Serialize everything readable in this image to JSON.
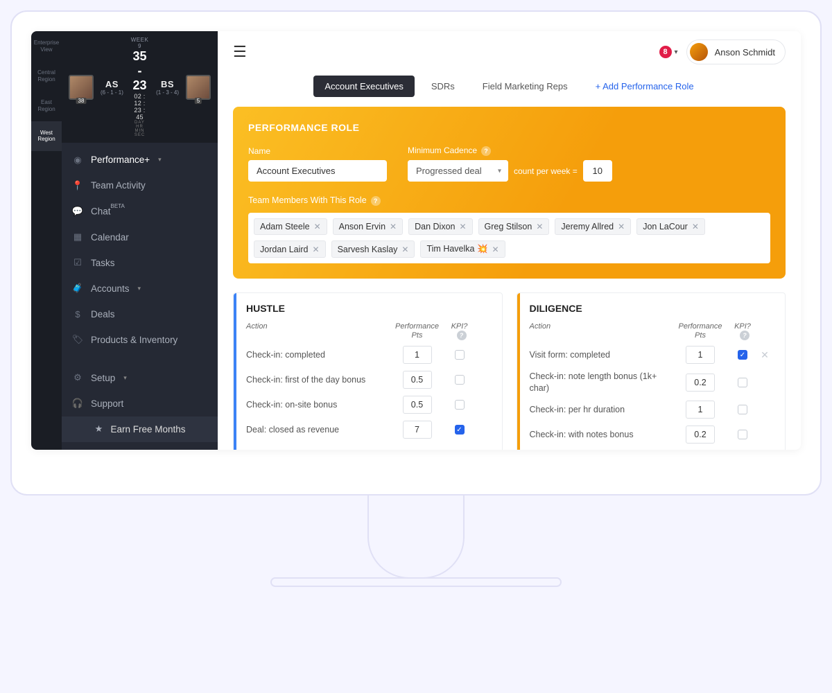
{
  "scoreboard": {
    "week": "WEEK 9",
    "leftTeam": "AS",
    "leftRecord": "(6 - 1 - 1)",
    "leftBadge": "38",
    "rightTeam": "BS",
    "rightRecord": "(1 - 3 - 4)",
    "rightBadge": "5",
    "score": "35 - 23",
    "countdown": "02 : 12 : 23 : 45",
    "countdownLabels": "DAY   HR   MIN   SEC"
  },
  "rail": [
    "Enterprise View",
    "Central Region",
    "East Region",
    "West Region"
  ],
  "nav": {
    "performance": "Performance+",
    "teamActivity": "Team Activity",
    "chat": "Chat",
    "chatBadge": "BETA",
    "calendar": "Calendar",
    "tasks": "Tasks",
    "accounts": "Accounts",
    "deals": "Deals",
    "products": "Products & Inventory",
    "setup": "Setup",
    "support": "Support",
    "earn": "Earn Free Months"
  },
  "topbar": {
    "notifCount": "8",
    "userName": "Anson Schmidt"
  },
  "tabs": {
    "ae": "Account Executives",
    "sdr": "SDRs",
    "fmr": "Field Marketing Reps",
    "add": "+ Add Performance Role"
  },
  "role": {
    "cardTitle": "PERFORMANCE ROLE",
    "nameLabel": "Name",
    "nameValue": "Account Executives",
    "cadenceLabel": "Minimum Cadence",
    "cadenceSelect": "Progressed deal",
    "cadenceText": "count per week =",
    "cadenceCount": "10",
    "membersLabel": "Team Members With This Role",
    "members": [
      "Adam Steele",
      "Anson Ervin",
      "Dan Dixon",
      "Greg Stilson",
      "Jeremy Allred",
      "Jon LaCour",
      "Jordan Laird",
      "Sarvesh Kaslay",
      "Tim Havelka 💥"
    ]
  },
  "panels": {
    "hustle": {
      "title": "HUSTLE",
      "headAction": "Action",
      "headPts": "Performance Pts",
      "headKpi": "KPI?",
      "rows": [
        {
          "action": "Check-in: completed",
          "pts": "1",
          "kpi": false
        },
        {
          "action": "Check-in: first of the day bonus",
          "pts": "0.5",
          "kpi": false
        },
        {
          "action": "Check-in: on-site bonus",
          "pts": "0.5",
          "kpi": false
        },
        {
          "action": "Deal: closed as revenue",
          "pts": "7",
          "kpi": true
        }
      ]
    },
    "diligence": {
      "title": "DILIGENCE",
      "headAction": "Action",
      "headPts": "Performance Pts",
      "headKpi": "KPI?",
      "rows": [
        {
          "action": "Visit form: completed",
          "pts": "1",
          "kpi": true,
          "del": true
        },
        {
          "action": "Check-in: note length bonus (1k+ char)",
          "pts": "0.2",
          "kpi": false
        },
        {
          "action": "Check-in: per hr duration",
          "pts": "1",
          "kpi": false
        },
        {
          "action": "Check-in: with notes bonus",
          "pts": "0.2",
          "kpi": false
        }
      ]
    }
  }
}
